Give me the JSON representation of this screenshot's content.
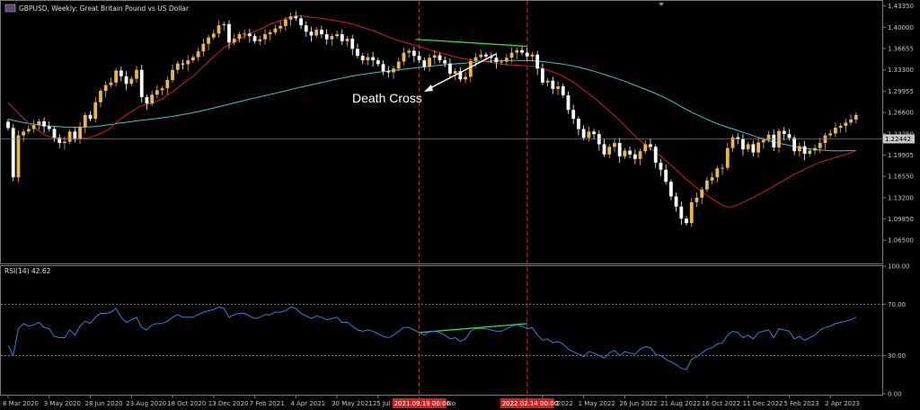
{
  "header": {
    "title": "GBPUSD, Weekly:  Great Britain Pound vs US Dollar"
  },
  "annotation": {
    "text": "Death Cross"
  },
  "rsi": {
    "label": "RSI(14) 42.62"
  },
  "price_label": "1.22442",
  "colors": {
    "up": "#e8b64a",
    "down": "#ffffff",
    "ma_fast": "#d02020",
    "ma_slow": "#3fc6c6",
    "rsi": "#3b7fd6",
    "highlight": "#35e035",
    "vline": "#c82828",
    "axis": "#7a7a7a"
  },
  "chart_data": [
    {
      "type": "candlestick",
      "title": "GBPUSD, Weekly:  Great Britain Pound vs US Dollar",
      "y_ticks": [
        "1.43350",
        "1.40000",
        "1.36655",
        "1.33300",
        "1.29955",
        "1.26600",
        "1.23250",
        "1.19905",
        "1.16550",
        "1.13200",
        "1.09850",
        "1.06500"
      ],
      "y_tick_values": [
        1.4335,
        1.4,
        1.36655,
        1.333,
        1.29955,
        1.266,
        1.2325,
        1.19905,
        1.1655,
        1.132,
        1.0985,
        1.065
      ],
      "ylim": [
        1.03,
        1.44
      ],
      "x_ticks": [
        "8 Mar 2020",
        "3 May 2020",
        "28 Jun 2020",
        "23 Aug 2020",
        "18 Oct 2020",
        "13 Dec 2020",
        "7 Feb 2021",
        "4 Apr 2021",
        "30 May 2021",
        "25 Jul 2021",
        "6 Mar 2022",
        "1 May 2022",
        "26 Jun 2022",
        "21 Aug 2022",
        "16 Oct 2022",
        "11 Dec 2022",
        "5 Feb 2023",
        "2 Apr 2023"
      ],
      "x_tick_weeks": [
        0,
        8,
        16,
        24,
        32,
        40,
        48,
        56,
        64,
        72,
        104,
        112,
        120,
        128,
        136,
        144,
        152,
        160
      ],
      "x_highlight_labels": [
        "2021.09.19 00:00",
        "2022.02.14 00:00"
      ],
      "x_highlight_weeks": [
        80,
        101
      ],
      "x_partial_labels": [
        "No",
        "2"
      ],
      "current_price": 1.22442,
      "close": [
        1.2415,
        1.164,
        1.23,
        1.236,
        1.24,
        1.246,
        1.252,
        1.244,
        1.24,
        1.226,
        1.218,
        1.22,
        1.236,
        1.225,
        1.243,
        1.262,
        1.256,
        1.282,
        1.3,
        1.309,
        1.313,
        1.332,
        1.323,
        1.311,
        1.319,
        1.333,
        1.29,
        1.28,
        1.294,
        1.301,
        1.304,
        1.317,
        1.333,
        1.343,
        1.342,
        1.348,
        1.353,
        1.362,
        1.374,
        1.384,
        1.39,
        1.403,
        1.405,
        1.376,
        1.382,
        1.389,
        1.39,
        1.386,
        1.378,
        1.381,
        1.389,
        1.392,
        1.398,
        1.402,
        1.412,
        1.417,
        1.414,
        1.403,
        1.393,
        1.387,
        1.396,
        1.389,
        1.381,
        1.386,
        1.389,
        1.378,
        1.382,
        1.366,
        1.355,
        1.348,
        1.353,
        1.348,
        1.342,
        1.331,
        1.329,
        1.335,
        1.346,
        1.36,
        1.363,
        1.355,
        1.348,
        1.338,
        1.352,
        1.356,
        1.348,
        1.343,
        1.327,
        1.331,
        1.318,
        1.322,
        1.347,
        1.353,
        1.357,
        1.354,
        1.352,
        1.345,
        1.346,
        1.352,
        1.36,
        1.364,
        1.36,
        1.354,
        1.357,
        1.335,
        1.313,
        1.316,
        1.303,
        1.307,
        1.293,
        1.27,
        1.256,
        1.24,
        1.226,
        1.236,
        1.232,
        1.216,
        1.2,
        1.212,
        1.218,
        1.197,
        1.206,
        1.2,
        1.193,
        1.205,
        1.216,
        1.212,
        1.187,
        1.176,
        1.157,
        1.134,
        1.118,
        1.099,
        1.092,
        1.125,
        1.132,
        1.145,
        1.159,
        1.164,
        1.178,
        1.179,
        1.21,
        1.227,
        1.224,
        1.208,
        1.216,
        1.203,
        1.219,
        1.223,
        1.231,
        1.211,
        1.237,
        1.232,
        1.226,
        1.205,
        1.213,
        1.201,
        1.206,
        1.21,
        1.218,
        1.23,
        1.233,
        1.242,
        1.245,
        1.25,
        1.255,
        1.262
      ],
      "sma_fast": [
        1.2815,
        1.2735,
        1.2648,
        1.2568,
        1.2493,
        1.2425,
        1.2365,
        1.2315,
        1.2279,
        1.2269,
        1.2254,
        1.2248,
        1.2245,
        1.2236,
        1.2243,
        1.2258,
        1.2268,
        1.2299,
        1.2332,
        1.2363,
        1.2423,
        1.2503,
        1.2566,
        1.2621,
        1.2671,
        1.2725,
        1.2765,
        1.2787,
        1.2807,
        1.2838,
        1.2874,
        1.2933,
        1.2985,
        1.3046,
        1.3113,
        1.3177,
        1.3225,
        1.3305,
        1.3386,
        1.3463,
        1.3537,
        1.3607,
        1.3678,
        1.3724,
        1.3768,
        1.3811,
        1.3854,
        1.3898,
        1.3935,
        1.3969,
        1.4006,
        1.405,
        1.4077,
        1.4103,
        1.4131,
        1.4162,
        1.4177,
        1.418,
        1.4169,
        1.4156,
        1.415,
        1.4141,
        1.4125,
        1.4112,
        1.4099,
        1.4085,
        1.4071,
        1.4049,
        1.4027,
        1.4,
        1.3974,
        1.3947,
        1.3916,
        1.3881,
        1.3848,
        1.3818,
        1.379,
        1.3766,
        1.3746,
        1.3722,
        1.3697,
        1.367,
        1.3646,
        1.3621,
        1.3599,
        1.3577,
        1.3555,
        1.3535,
        1.3516,
        1.3499,
        1.3486,
        1.3478,
        1.3469,
        1.3458,
        1.3445,
        1.3431,
        1.342,
        1.3411,
        1.3406,
        1.3403,
        1.3398,
        1.3394,
        1.339,
        1.3373,
        1.3349,
        1.3327,
        1.3297,
        1.3266,
        1.323,
        1.3184,
        1.3134,
        1.3076,
        1.3011,
        1.2954,
        1.2894,
        1.2826,
        1.2751,
        1.268,
        1.2609,
        1.2531,
        1.2453,
        1.237,
        1.2287,
        1.2215,
        1.2155,
        1.2099,
        1.2034,
        1.1971,
        1.1905,
        1.1831,
        1.1756,
        1.1682,
        1.1606,
        1.1543,
        1.1475,
        1.1415,
        1.1357,
        1.1301,
        1.1252,
        1.1205,
        1.1176,
        1.1179,
        1.1207,
        1.1244,
        1.1285,
        1.1326,
        1.1369,
        1.1411,
        1.1456,
        1.1498,
        1.155,
        1.1595,
        1.1642,
        1.169,
        1.1728,
        1.1769,
        1.1806,
        1.1842,
        1.1877,
        1.1903,
        1.1927,
        1.1953,
        1.1975,
        1.2001,
        1.2028,
        1.2061
      ],
      "sma_slow": [
        1.2555,
        1.2535,
        1.2518,
        1.2502,
        1.2488,
        1.2475,
        1.2464,
        1.2455,
        1.2447,
        1.2442,
        1.2436,
        1.2432,
        1.243,
        1.2427,
        1.2427,
        1.243,
        1.2433,
        1.244,
        1.2449,
        1.2459,
        1.247,
        1.2484,
        1.2496,
        1.2506,
        1.2516,
        1.2528,
        1.2538,
        1.2547,
        1.2557,
        1.2566,
        1.2576,
        1.2587,
        1.2599,
        1.2613,
        1.2627,
        1.2642,
        1.2657,
        1.2674,
        1.2691,
        1.271,
        1.273,
        1.275,
        1.2771,
        1.2789,
        1.2809,
        1.2829,
        1.2849,
        1.2869,
        1.2888,
        1.2906,
        1.2925,
        1.2943,
        1.2962,
        1.2981,
        1.3,
        1.3021,
        1.304,
        1.3058,
        1.3076,
        1.3094,
        1.3113,
        1.3131,
        1.3148,
        1.3166,
        1.3184,
        1.3201,
        1.3218,
        1.3233,
        1.3247,
        1.3259,
        1.3271,
        1.3282,
        1.3293,
        1.3302,
        1.3311,
        1.332,
        1.333,
        1.334,
        1.335,
        1.3359,
        1.3368,
        1.3376,
        1.3385,
        1.3394,
        1.3402,
        1.341,
        1.3417,
        1.3424,
        1.343,
        1.3436,
        1.3444,
        1.3451,
        1.3458,
        1.3463,
        1.3468,
        1.3471,
        1.3474,
        1.3476,
        1.3477,
        1.3477,
        1.3476,
        1.3475,
        1.3474,
        1.3468,
        1.346,
        1.3452,
        1.3441,
        1.3431,
        1.342,
        1.3406,
        1.339,
        1.3372,
        1.3352,
        1.3331,
        1.3309,
        1.3284,
        1.3258,
        1.3232,
        1.3206,
        1.3178,
        1.315,
        1.3119,
        1.3087,
        1.3056,
        1.3025,
        1.2993,
        1.2958,
        1.2922,
        1.2884,
        1.2842,
        1.2797,
        1.2751,
        1.2706,
        1.2666,
        1.2627,
        1.2589,
        1.2552,
        1.2517,
        1.2484,
        1.2452,
        1.2426,
        1.2401,
        1.2376,
        1.2348,
        1.2322,
        1.2294,
        1.2268,
        1.2243,
        1.222,
        1.2196,
        1.2176,
        1.2159,
        1.2143,
        1.2126,
        1.2112,
        1.2098,
        1.2087,
        1.2078,
        1.207,
        1.2064,
        1.2059,
        1.2057,
        1.2057,
        1.2058,
        1.2059,
        1.206
      ],
      "annotation": "Death Cross"
    },
    {
      "type": "line",
      "title": "RSI(14) 42.62",
      "y_ticks": [
        "100.00",
        "70.00",
        "30.00",
        "0.00"
      ],
      "y_tick_values": [
        100,
        70,
        30,
        0
      ],
      "ylim": [
        0,
        100
      ],
      "reference_lines": [
        70,
        30
      ],
      "current": 42.62,
      "values": [
        38,
        30,
        51,
        55,
        53,
        54,
        56,
        52,
        51,
        45,
        44,
        44,
        50,
        46,
        53,
        57,
        55,
        60,
        63,
        63,
        64,
        67,
        60,
        56,
        58,
        60,
        52,
        50,
        54,
        55,
        55,
        57,
        60,
        62,
        60,
        60,
        60,
        62,
        64,
        65,
        66,
        68,
        67,
        60,
        62,
        63,
        63,
        61,
        59,
        60,
        62,
        62,
        64,
        64,
        65,
        68,
        67,
        63,
        61,
        59,
        61,
        60,
        58,
        59,
        60,
        56,
        56,
        53,
        50,
        49,
        50,
        49,
        47,
        45,
        44,
        46,
        49,
        52,
        52,
        50,
        48,
        46,
        49,
        49,
        48,
        46,
        43,
        44,
        41,
        43,
        49,
        51,
        51,
        51,
        50,
        49,
        49,
        51,
        53,
        54,
        53,
        51,
        52,
        46,
        42,
        43,
        40,
        41,
        39,
        35,
        33,
        31,
        29,
        33,
        32,
        30,
        28,
        32,
        34,
        30,
        33,
        32,
        31,
        35,
        37,
        36,
        31,
        30,
        27,
        25,
        23,
        20,
        19,
        27,
        29,
        32,
        35,
        36,
        39,
        40,
        46,
        49,
        48,
        44,
        46,
        43,
        48,
        49,
        50,
        44,
        51,
        50,
        49,
        43,
        45,
        42,
        44,
        46,
        50,
        52,
        53,
        55,
        56,
        57,
        58,
        60
      ]
    }
  ]
}
